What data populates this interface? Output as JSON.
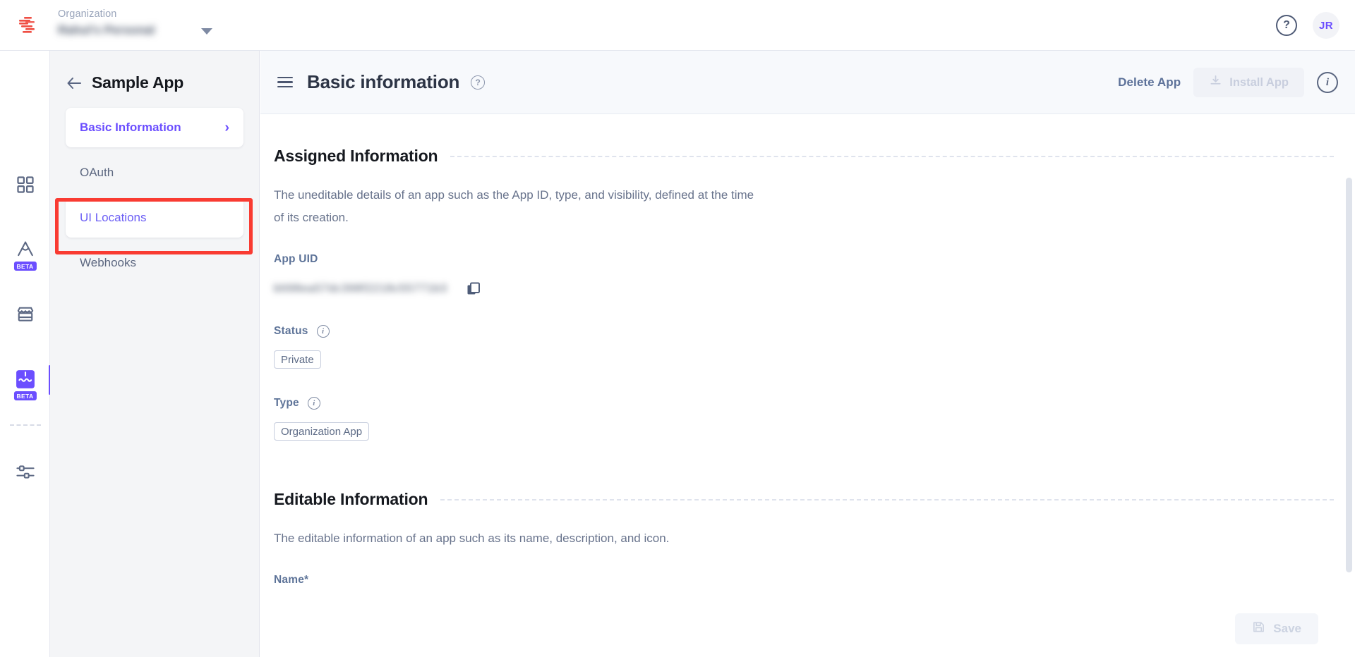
{
  "topbar": {
    "logo_icon": "contentstack-logo-icon",
    "org_label": "Organization",
    "org_value": "Rahul's Personal",
    "org_caret_icon": "chevron-down-icon",
    "help_icon": "help-circle-icon",
    "help_glyph": "?",
    "avatar_initials": "JR"
  },
  "rail": {
    "items": [
      {
        "name": "dashboard",
        "icon": "grid-icon",
        "badge": "",
        "active": false
      },
      {
        "name": "automations",
        "icon": "compass-icon",
        "badge": "BETA",
        "active": false
      },
      {
        "name": "marketplace",
        "icon": "store-icon",
        "badge": "",
        "active": false
      },
      {
        "name": "apps",
        "icon": "puzzle-icon",
        "badge": "BETA",
        "active": true
      },
      {
        "name": "settings",
        "icon": "sliders-icon",
        "badge": "",
        "active": false
      }
    ]
  },
  "sidebar": {
    "back_icon": "arrow-left-icon",
    "title": "Sample App",
    "items": [
      {
        "label": "Basic Information",
        "state": "active",
        "chevron_icon": "chevron-right-icon",
        "chevron": "›"
      },
      {
        "label": "OAuth",
        "state": "default"
      },
      {
        "label": "UI Locations",
        "state": "selected"
      },
      {
        "label": "Webhooks",
        "state": "default"
      }
    ],
    "annotation": {
      "target": "UI Locations",
      "color": "#f93b32"
    }
  },
  "header": {
    "menu_icon": "hamburger-menu-icon",
    "title": "Basic information",
    "help_icon": "help-circle-icon",
    "help_glyph": "?",
    "delete_label": "Delete App",
    "install_label": "Install App",
    "install_icon": "download-install-icon",
    "install_disabled": true,
    "info_icon": "info-circle-icon",
    "info_glyph": "i"
  },
  "assigned": {
    "title": "Assigned Information",
    "description": "The uneditable details of an app such as the App ID, type, and visibility, defined at the time of its creation.",
    "app_uid_label": "App UID",
    "app_uid_value": "blt98ea57dc398f2218c55771b3",
    "copy_icon": "copy-icon",
    "status_label": "Status",
    "status_info_icon": "info-circle-icon",
    "status_value": "Private",
    "type_label": "Type",
    "type_info_icon": "info-circle-icon",
    "type_value": "Organization App"
  },
  "editable": {
    "title": "Editable Information",
    "description": "The editable information of an app such as its name, description, and icon.",
    "name_label": "Name*",
    "name_value": "",
    "name_placeholder": ""
  },
  "footer": {
    "save_label": "Save",
    "save_icon": "save-disk-icon",
    "save_disabled": true
  },
  "colors": {
    "accent_purple": "#6b4eff",
    "annotation_red": "#f93b32",
    "logo_red": "#ef4e43",
    "text_dark": "#16191f",
    "text_muted": "#68738c"
  }
}
